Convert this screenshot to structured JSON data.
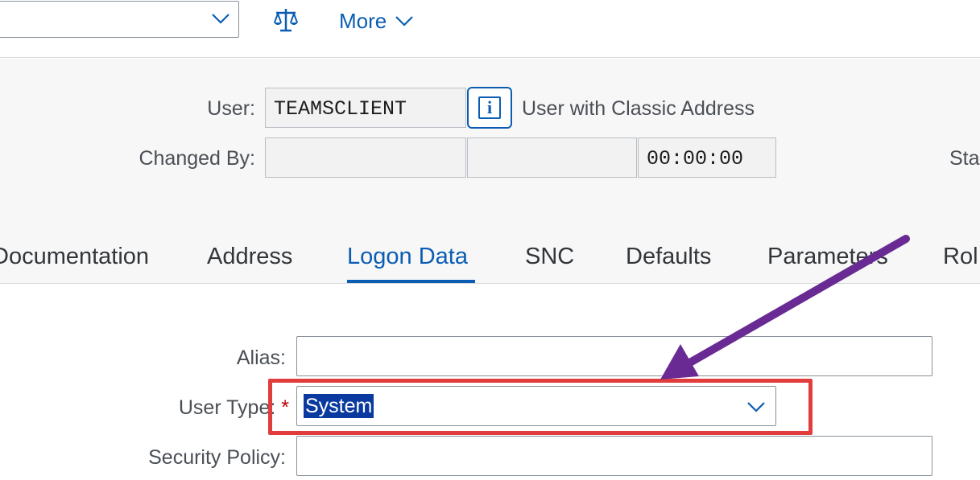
{
  "toolbar": {
    "more_label": "More",
    "icons": [
      "chevron-down-icon",
      "scale-icon"
    ]
  },
  "header": {
    "user_label": "User:",
    "user_value": "TEAMSCLIENT",
    "user_description": "User with Classic Address",
    "changed_by_label": "Changed By:",
    "changed_by_value": "",
    "changed_date_value": "",
    "changed_time_value": "00:00:00",
    "status_label_partial": "Sta"
  },
  "tabs": [
    {
      "label": "Documentation",
      "active": false
    },
    {
      "label": "Address",
      "active": false
    },
    {
      "label": "Logon Data",
      "active": true
    },
    {
      "label": "SNC",
      "active": false
    },
    {
      "label": "Defaults",
      "active": false
    },
    {
      "label": "Parameters",
      "active": false
    },
    {
      "label": "Rol",
      "active": false
    }
  ],
  "form": {
    "alias_label": "Alias:",
    "alias_value": "",
    "user_type_label": "User Type:",
    "user_type_required": "*",
    "user_type_value": "System",
    "security_policy_label": "Security Policy:",
    "security_policy_value": ""
  },
  "colors": {
    "accent": "#0a5db3",
    "highlight_box": "#e23d3d",
    "annotation_arrow": "#6a2a94",
    "required": "#bb0000"
  }
}
